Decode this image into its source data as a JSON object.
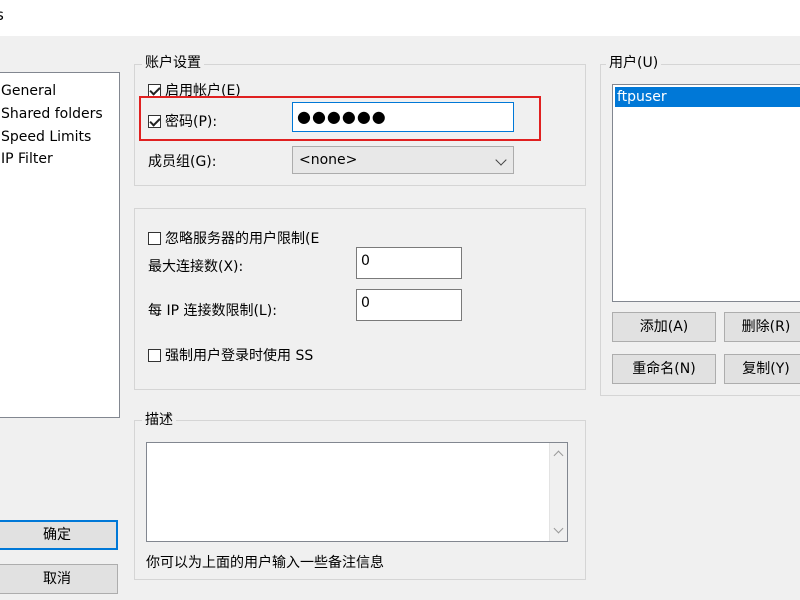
{
  "window": {
    "title": "s"
  },
  "sidebar": {
    "items": [
      "General",
      "Shared folders",
      "Speed Limits",
      "IP Filter"
    ]
  },
  "account_settings": {
    "group_title": "账户设置",
    "enable_account": "启用帐户(E)",
    "password_label": "密码(P):",
    "password_value": "●●●●●●",
    "member_group_label": "成员组(G):",
    "member_group_value": "<none>"
  },
  "limits": {
    "ignore_server_limits": "忽略服务器的用户限制(E",
    "max_connections_label": "最大连接数(X):",
    "max_connections_value": "0",
    "per_ip_label": "每 IP 连接数限制(L):",
    "per_ip_value": "0",
    "force_ssl": "强制用户登录时使用 SS"
  },
  "description": {
    "group_title": "描述",
    "hint": "你可以为上面的用户输入一些备注信息"
  },
  "users": {
    "group_title": "用户(U)",
    "list": [
      "ftpuser"
    ],
    "add_button": "添加(A)",
    "delete_button": "删除(R)",
    "rename_button": "重命名(N)",
    "copy_button": "复制(Y)"
  },
  "footer": {
    "ok_button": "确定",
    "cancel_button": "取消"
  },
  "colors": {
    "highlight": "#e02020",
    "selection": "#0078d7"
  }
}
